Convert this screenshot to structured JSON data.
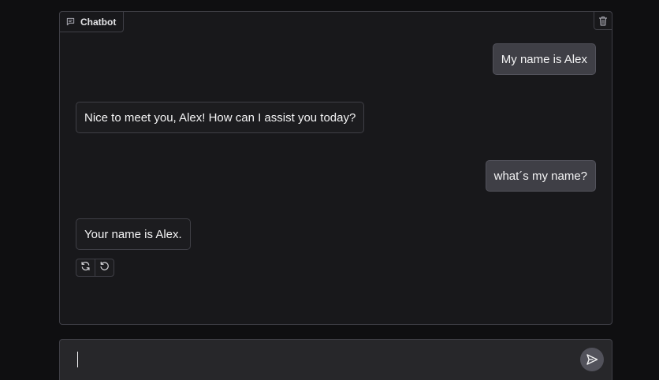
{
  "chatbot": {
    "label": "Chatbot",
    "label_icon": "chat-icon",
    "clear_icon": "trash-icon"
  },
  "messages": [
    {
      "role": "user",
      "text": "My name is Alex"
    },
    {
      "role": "bot",
      "text": "Nice to meet you, Alex! How can I assist you today?"
    },
    {
      "role": "user",
      "text": "what´s my name?"
    },
    {
      "role": "bot",
      "text": "Your name is Alex."
    }
  ],
  "message_actions": {
    "retry_icon": "retry-icon",
    "undo_icon": "undo-icon"
  },
  "input": {
    "value": "",
    "placeholder": "",
    "send_icon": "send-icon"
  },
  "colors": {
    "background": "#0f0f11",
    "panel": "#18181b",
    "border": "#3f3f46",
    "user_bubble": "#3f3f46",
    "input_bg": "#27272a",
    "send_button": "#52525b"
  }
}
